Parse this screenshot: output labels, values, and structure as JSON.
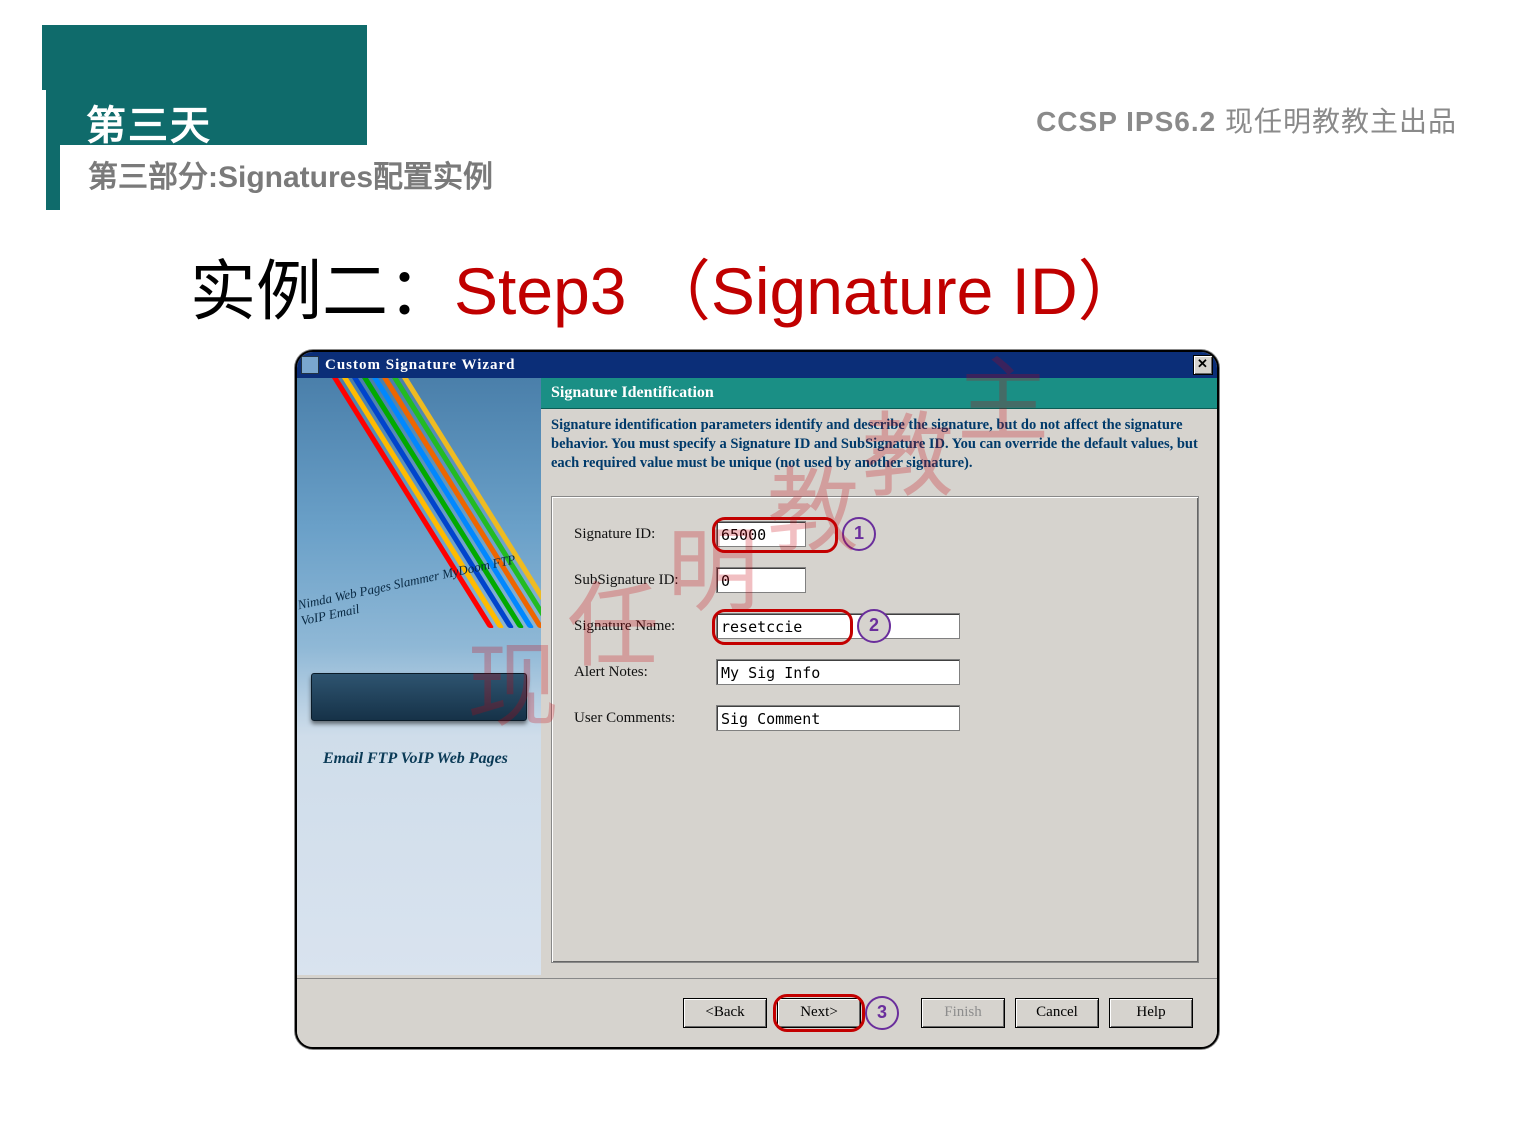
{
  "header": {
    "day": "第三天",
    "subtitle": "第三部分:Signatures配置实例",
    "course": "CCSP IPS6.2",
    "author": "现任明教教主出品"
  },
  "title": {
    "zh": "实例二：",
    "en": "Step3 （Signature ID）"
  },
  "dialog": {
    "window_title": "Custom Signature Wizard",
    "close_glyph": "✕",
    "section_header": "Signature Identification",
    "section_desc": "Signature identification parameters identify and describe the signature, but do not affect the signature behavior. You must specify a Signature ID and SubSignature ID. You can override the default values, but each required value must be unique (not used by another signature).",
    "fields": {
      "signature_id": {
        "label": "Signature ID:",
        "value": "65000"
      },
      "subsignature_id": {
        "label": "SubSignature ID:",
        "value": "0"
      },
      "signature_name": {
        "label": "Signature Name:",
        "value": "resetccie"
      },
      "alert_notes": {
        "label": "Alert Notes:",
        "value": "My Sig Info"
      },
      "user_comments": {
        "label": "User Comments:",
        "value": "Sig Comment"
      }
    },
    "buttons": {
      "back": "<Back",
      "next": "Next>",
      "finish": "Finish",
      "cancel": "Cancel",
      "help": "Help"
    },
    "left_pane": {
      "threat_words": "Nimda Web Pages Slammer MyDoom FTP VoIP Email",
      "bottom_words": "Email FTP VoIP Web Pages"
    },
    "callouts": {
      "one": "1",
      "two": "2",
      "three": "3"
    },
    "watermark": "现任明教教主"
  }
}
